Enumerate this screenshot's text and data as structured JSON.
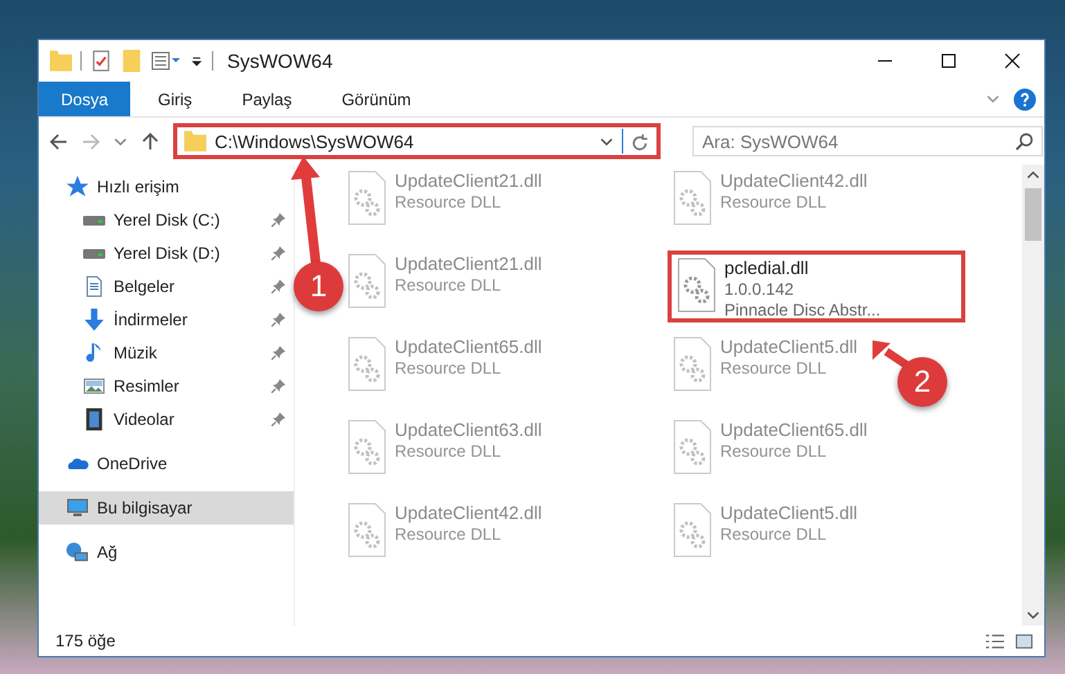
{
  "window": {
    "title": "SysWOW64"
  },
  "ribbon": {
    "tabs": [
      {
        "label": "Dosya",
        "selected": true
      },
      {
        "label": "Giriş",
        "selected": false
      },
      {
        "label": "Paylaş",
        "selected": false
      },
      {
        "label": "Görünüm",
        "selected": false
      }
    ]
  },
  "address_bar": {
    "path": "C:\\Windows\\SysWOW64",
    "highlighted": true
  },
  "search": {
    "placeholder": "Ara: SysWOW64"
  },
  "sidebar": {
    "items": [
      {
        "label": "Hızlı erişim",
        "selected": false,
        "children": [
          {
            "label": "Yerel Disk (C:)",
            "pinned": true,
            "selected": false
          },
          {
            "label": "Yerel Disk (D:)",
            "pinned": true,
            "selected": false
          },
          {
            "label": "Belgeler",
            "pinned": true,
            "selected": false
          },
          {
            "label": "İndirmeler",
            "pinned": true,
            "selected": false
          },
          {
            "label": "Müzik",
            "pinned": true,
            "selected": false
          },
          {
            "label": "Resimler",
            "pinned": true,
            "selected": false
          },
          {
            "label": "Videolar",
            "pinned": true,
            "selected": false
          }
        ]
      },
      {
        "label": "OneDrive",
        "selected": false
      },
      {
        "label": "Bu bilgisayar",
        "selected": true
      },
      {
        "label": "Ağ",
        "selected": false
      }
    ]
  },
  "files": [
    {
      "name": "UpdateClient21.dll",
      "details": [
        "Resource DLL"
      ],
      "dimmed": true,
      "highlighted": false
    },
    {
      "name": "UpdateClient42.dll",
      "details": [
        "Resource DLL"
      ],
      "dimmed": true,
      "highlighted": false
    },
    {
      "name": "UpdateClient21.dll",
      "details": [
        "Resource DLL"
      ],
      "dimmed": true,
      "highlighted": false
    },
    {
      "name": "pcledial.dll",
      "details": [
        "1.0.0.142",
        "Pinnacle Disc Abstr..."
      ],
      "dimmed": false,
      "highlighted": true
    },
    {
      "name": "UpdateClient65.dll",
      "details": [
        "Resource DLL"
      ],
      "dimmed": true,
      "highlighted": false
    },
    {
      "name": "UpdateClient5.dll",
      "details": [
        "Resource DLL"
      ],
      "dimmed": true,
      "highlighted": false
    },
    {
      "name": "UpdateClient63.dll",
      "details": [
        "Resource DLL"
      ],
      "dimmed": true,
      "highlighted": false
    },
    {
      "name": "UpdateClient65.dll",
      "details": [
        "Resource DLL"
      ],
      "dimmed": true,
      "highlighted": false
    },
    {
      "name": "UpdateClient42.dll",
      "details": [
        "Resource DLL"
      ],
      "dimmed": true,
      "highlighted": false
    },
    {
      "name": "UpdateClient5.dll",
      "details": [
        "Resource DLL"
      ],
      "dimmed": true,
      "highlighted": false
    }
  ],
  "status_bar": {
    "count": "175 öğe"
  },
  "annotations": [
    {
      "number": "1"
    },
    {
      "number": "2"
    }
  ]
}
